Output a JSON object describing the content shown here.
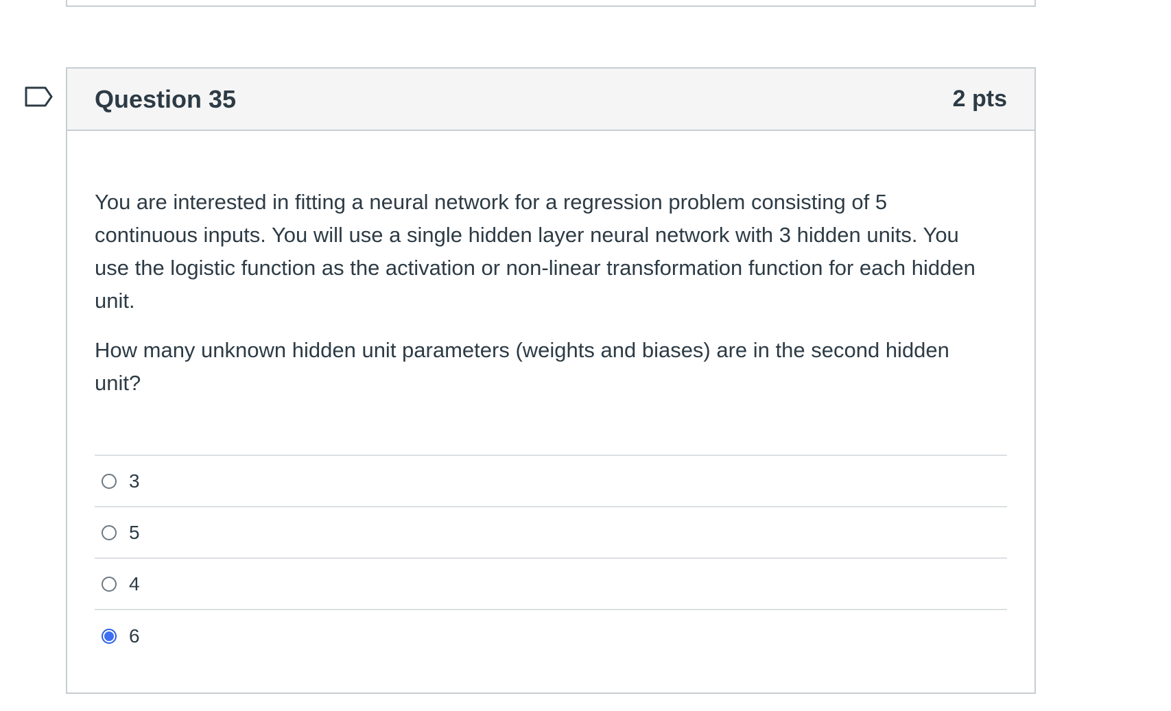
{
  "question": {
    "title": "Question 35",
    "points": "2 pts",
    "paragraphs": [
      "You are interested in fitting a neural network for a regression problem consisting of 5 continuous inputs. You will use a single hidden layer neural network with 3 hidden units. You use the logistic function as the activation or non-linear transformation function for each hidden unit.",
      "How many unknown hidden unit parameters (weights and biases) are in the second hidden unit?"
    ],
    "answers": [
      {
        "label": "3",
        "selected": false
      },
      {
        "label": "5",
        "selected": false
      },
      {
        "label": "4",
        "selected": false
      },
      {
        "label": "6",
        "selected": true
      }
    ]
  },
  "colors": {
    "accent": "#3c6ff2",
    "border": "#c7cdd1",
    "header_bg": "#f5f5f5",
    "text": "#2d3b45"
  },
  "icons": {
    "flag": "flag-question-icon",
    "radio": "radio-button-icon"
  }
}
